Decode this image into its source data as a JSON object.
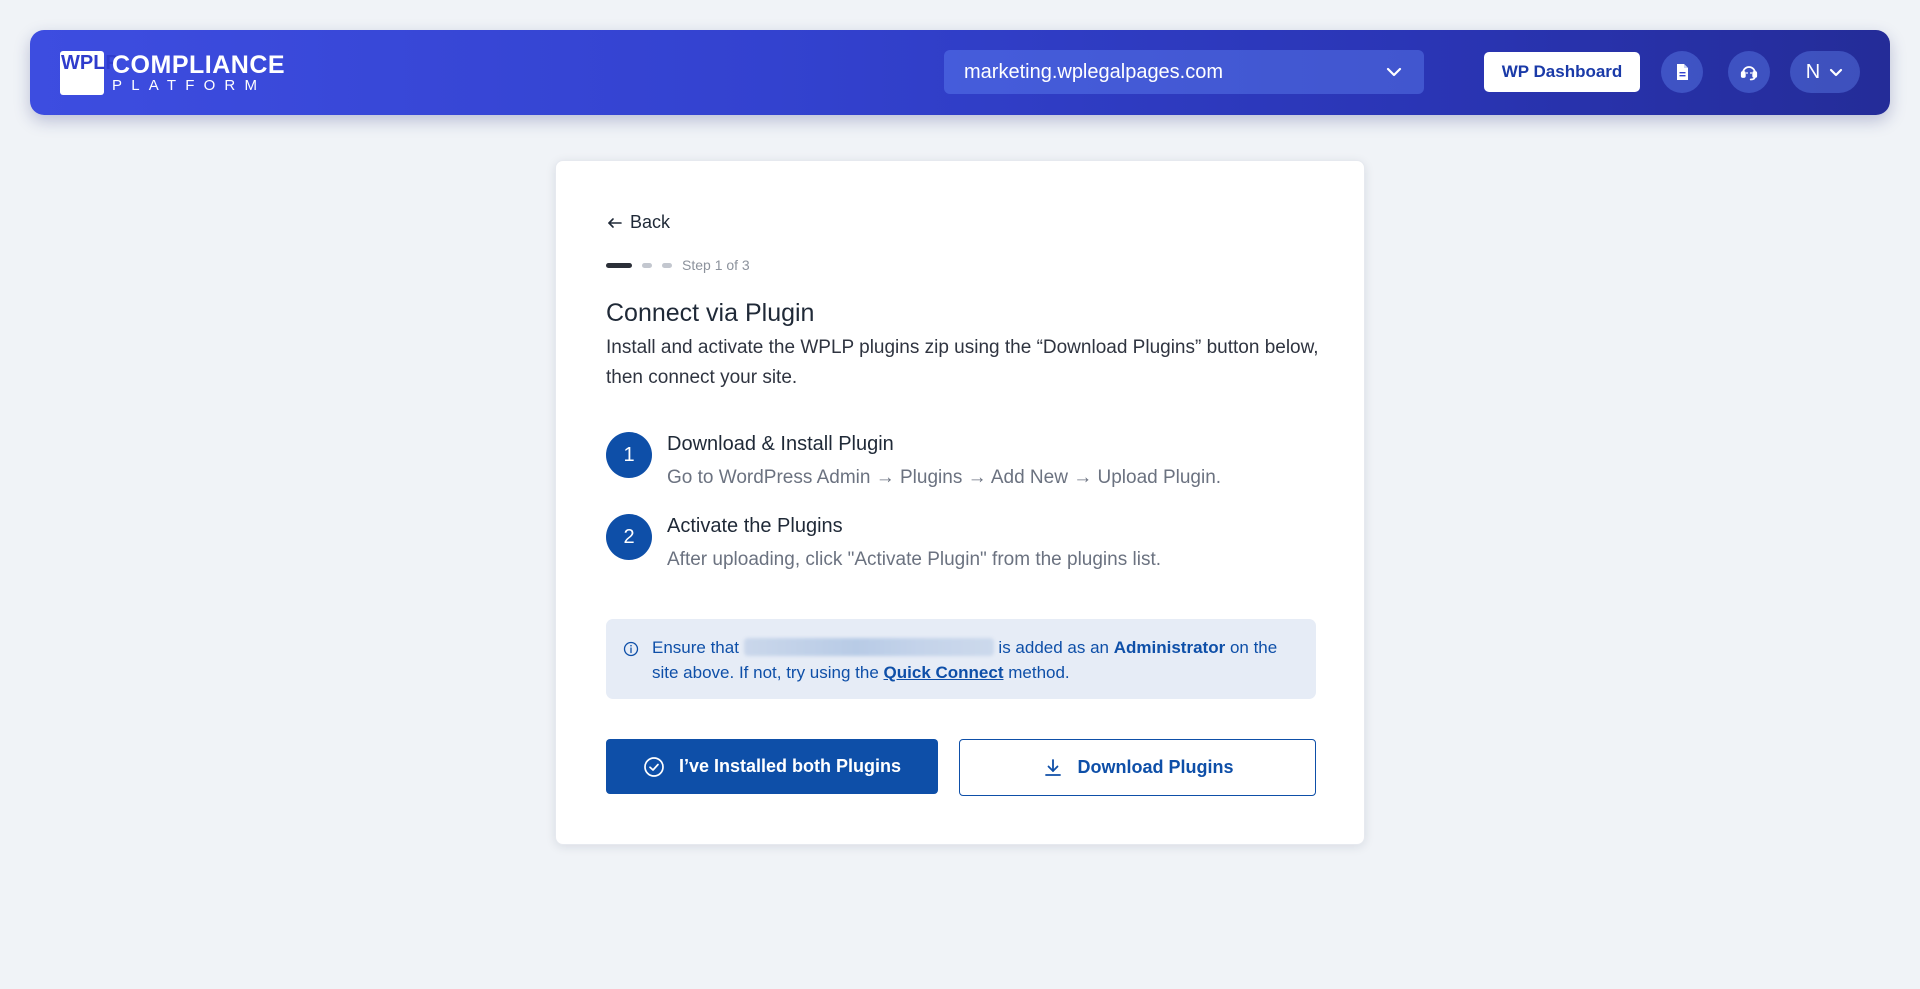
{
  "header": {
    "logo": {
      "mark": [
        "WP",
        "LP"
      ],
      "line1": "COMPLIANCE",
      "line2": "PLATFORM"
    },
    "site_select": {
      "value": "marketing.wplegalpages.com",
      "icon": "chevron-down-icon"
    },
    "wp_dashboard_label": "WP Dashboard",
    "icons": [
      "document-icon",
      "support-icon"
    ],
    "user": {
      "initial": "N",
      "icon": "chevron-down-icon"
    }
  },
  "card": {
    "back_label": "Back",
    "step_indicator": "Step 1 of 3",
    "current_step": 1,
    "total_steps": 3,
    "title": "Connect via Plugin",
    "description": "Install and activate the WPLP plugins zip using the “Download Plugins” button below, then connect your site.",
    "steps": [
      {
        "number": "1",
        "title": "Download & Install Plugin",
        "subtitle": "Go to WordPress Admin → Plugins → Add New → Upload Plugin."
      },
      {
        "number": "2",
        "title": "Activate the Plugins",
        "subtitle": "After uploading, click \"Activate Plugin\" from the plugins list."
      }
    ],
    "notice": {
      "prefix": "Ensure that",
      "middle": "is added as an",
      "role": "Administrator",
      "suffix1": "on the site above. If not, try using the",
      "link": "Quick Connect",
      "suffix2": "method."
    },
    "primary_button": "I’ve Installed both Plugins",
    "secondary_button": "Download Plugins"
  },
  "colors": {
    "header_gradient_start": "#3d4de0",
    "header_gradient_end": "#242c98",
    "primary": "#0e4fa8",
    "background": "#f0f3f7",
    "notice_bg": "#e6ecf6"
  }
}
